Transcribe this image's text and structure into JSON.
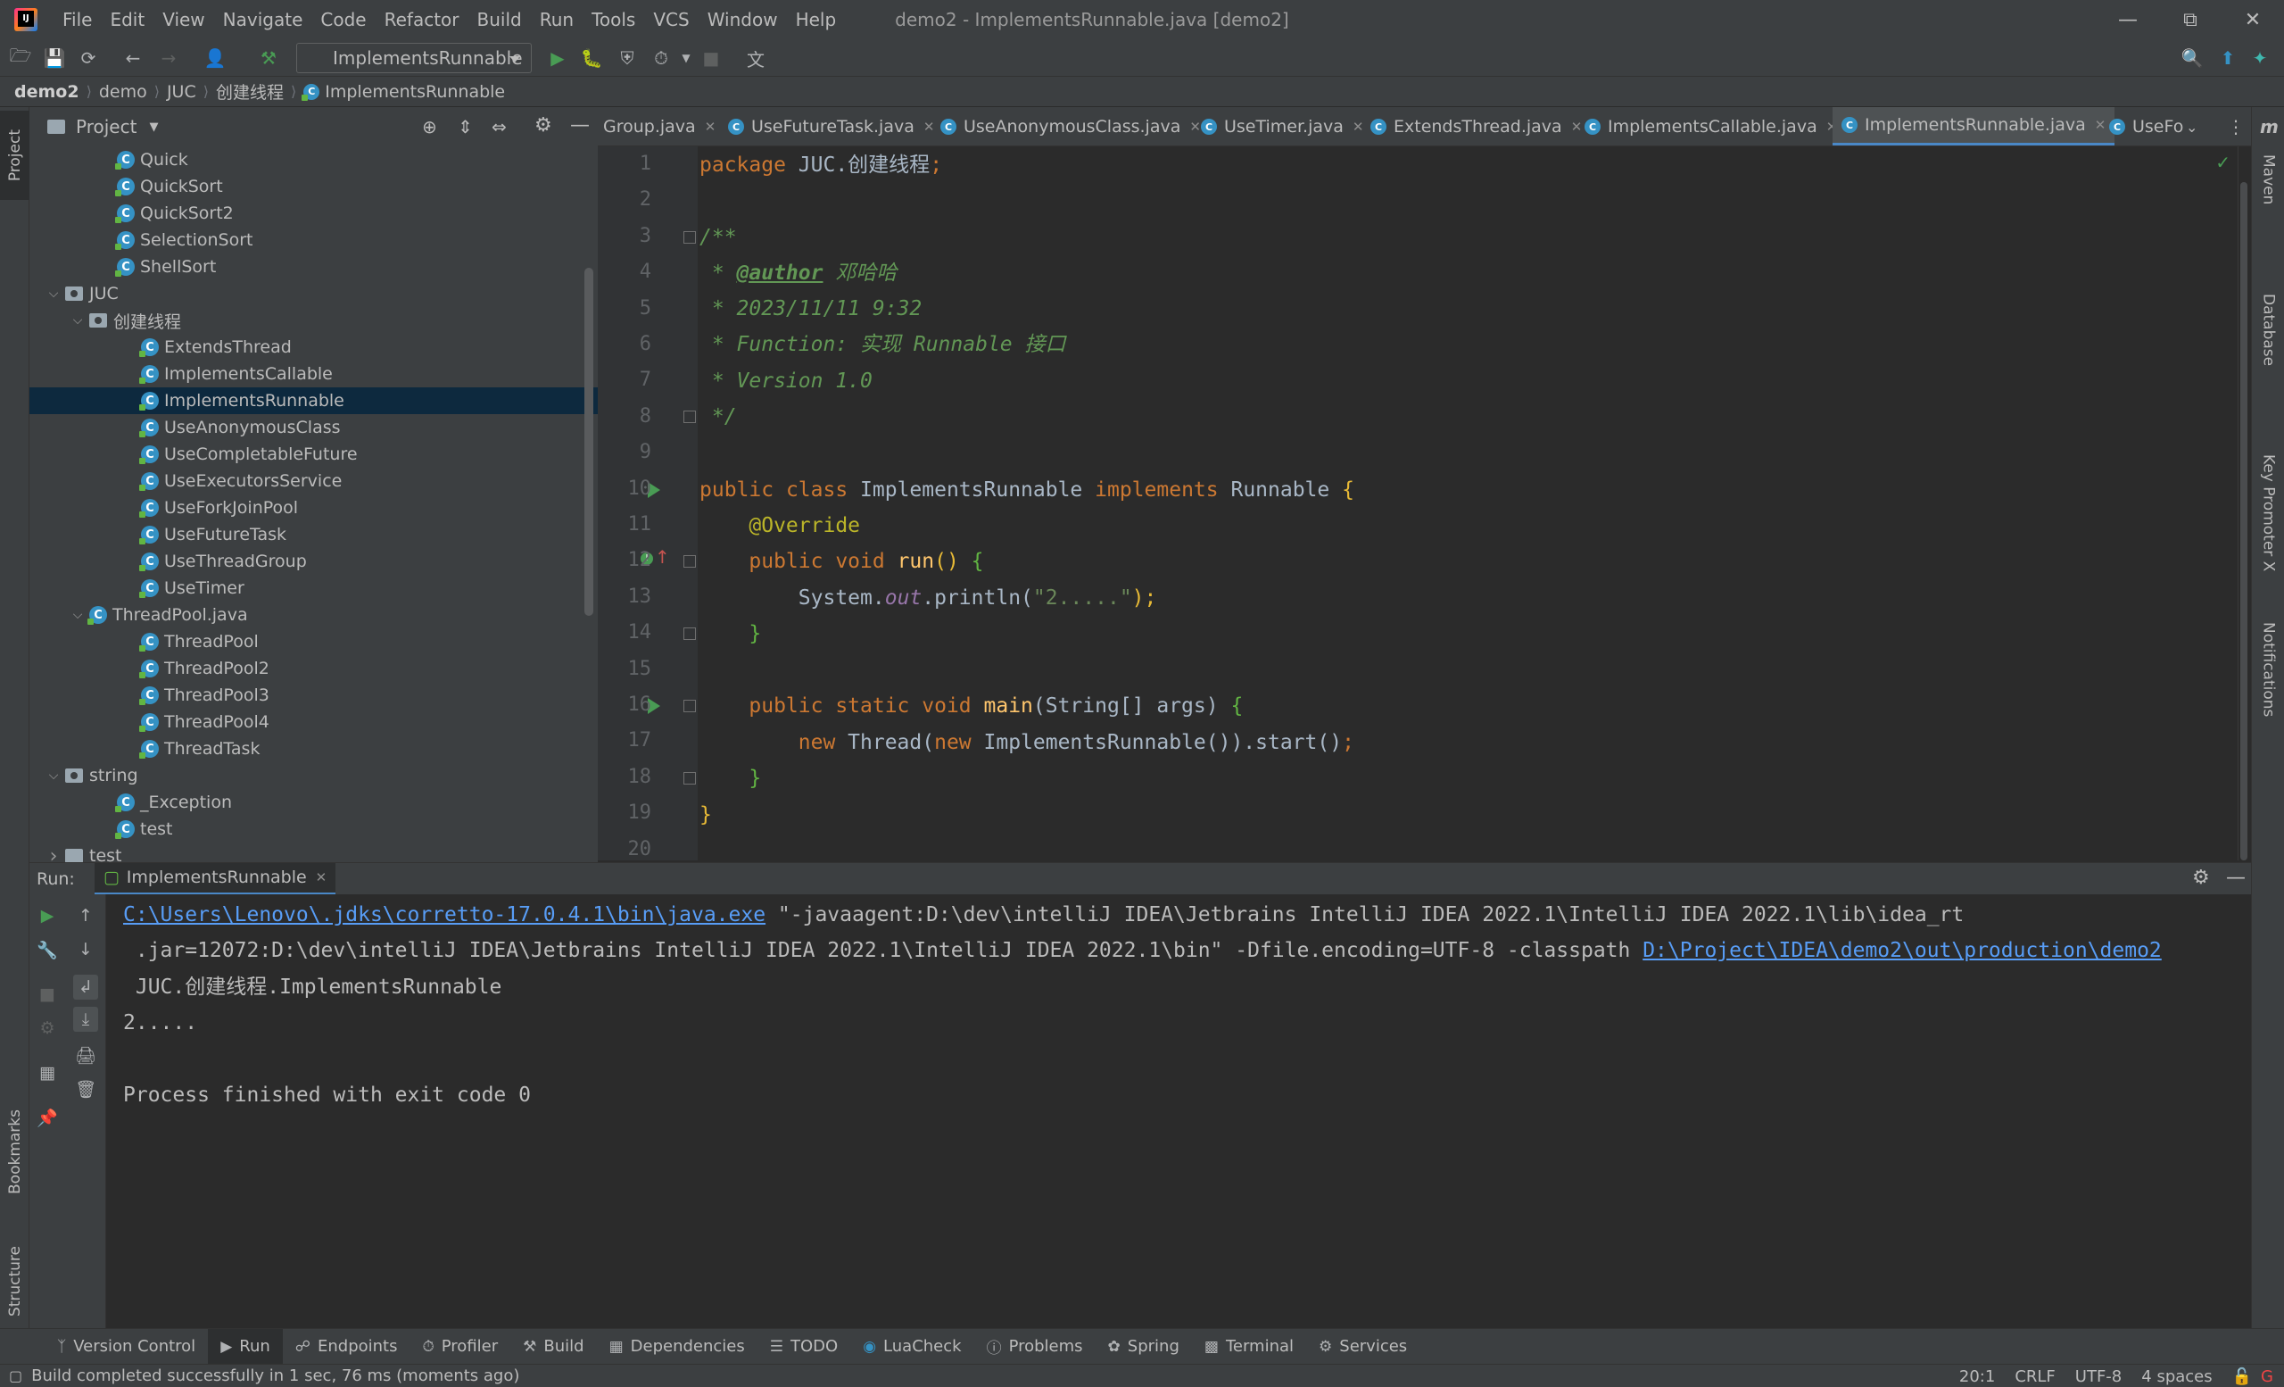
{
  "titlebar": {
    "menus": [
      {
        "label": "File"
      },
      {
        "label": "Edit"
      },
      {
        "label": "View"
      },
      {
        "label": "Navigate"
      },
      {
        "label": "Code"
      },
      {
        "label": "Refactor"
      },
      {
        "label": "Build"
      },
      {
        "label": "Run"
      },
      {
        "label": "Tools"
      },
      {
        "label": "VCS"
      },
      {
        "label": "Window"
      },
      {
        "label": "Help"
      }
    ],
    "window_title": "demo2 - ImplementsRunnable.java [demo2]"
  },
  "toolbar": {
    "run_config": "ImplementsRunnable"
  },
  "breadcrumb": [
    "demo2",
    "demo",
    "JUC",
    "创建线程",
    "ImplementsRunnable"
  ],
  "left_stripe": {
    "project": "Project",
    "bookmarks": "Bookmarks",
    "structure": "Structure"
  },
  "right_stripe": {
    "maven": "Maven",
    "database": "Database",
    "key_promoter": "Key Promoter X",
    "notifications": "Notifications"
  },
  "project_panel": {
    "title": "Project",
    "tree": [
      {
        "label": "Quick",
        "type": "class"
      },
      {
        "label": "QuickSort",
        "type": "class"
      },
      {
        "label": "QuickSort2",
        "type": "class"
      },
      {
        "label": "SelectionSort",
        "type": "class"
      },
      {
        "label": "ShellSort",
        "type": "class"
      },
      {
        "label": "JUC",
        "type": "package",
        "expanded": true
      },
      {
        "label": "创建线程",
        "type": "package",
        "expanded": true
      },
      {
        "label": "ExtendsThread",
        "type": "class"
      },
      {
        "label": "ImplementsCallable",
        "type": "class"
      },
      {
        "label": "ImplementsRunnable",
        "type": "class",
        "selected": true
      },
      {
        "label": "UseAnonymousClass",
        "type": "class"
      },
      {
        "label": "UseCompletableFuture",
        "type": "class"
      },
      {
        "label": "UseExecutorsService",
        "type": "class"
      },
      {
        "label": "UseForkJoinPool",
        "type": "class"
      },
      {
        "label": "UseFutureTask",
        "type": "class"
      },
      {
        "label": "UseThreadGroup",
        "type": "class"
      },
      {
        "label": "UseTimer",
        "type": "class"
      },
      {
        "label": "ThreadPool.java",
        "type": "file",
        "expanded": true
      },
      {
        "label": "ThreadPool",
        "type": "class"
      },
      {
        "label": "ThreadPool2",
        "type": "class"
      },
      {
        "label": "ThreadPool3",
        "type": "class"
      },
      {
        "label": "ThreadPool4",
        "type": "class"
      },
      {
        "label": "ThreadTask",
        "type": "class"
      },
      {
        "label": "string",
        "type": "package",
        "expanded": true
      },
      {
        "label": "_Exception",
        "type": "class"
      },
      {
        "label": "test",
        "type": "class"
      },
      {
        "label": "test",
        "type": "folder",
        "expanded": false
      }
    ]
  },
  "editor_tabs": [
    {
      "label": "Group.java"
    },
    {
      "label": "UseFutureTask.java"
    },
    {
      "label": "UseAnonymousClass.java"
    },
    {
      "label": "UseTimer.java"
    },
    {
      "label": "ExtendsThread.java"
    },
    {
      "label": "ImplementsCallable.java"
    },
    {
      "label": "ImplementsRunnable.java",
      "active": true
    },
    {
      "label": "UseFo"
    }
  ],
  "code": {
    "line_numbers": [
      "1",
      "2",
      "3",
      "4",
      "5",
      "6",
      "7",
      "8",
      "9",
      "10",
      "11",
      "12",
      "13",
      "14",
      "15",
      "16",
      "17",
      "18",
      "19",
      "20"
    ],
    "l1_kw": "package",
    "l1_rest": " JUC.创建线程",
    "l1_semi": ";",
    "l3": "/**",
    "l4_star": " * ",
    "l4_tag": "@author",
    "l4_rest": " 邓哈哈",
    "l5": " * 2023/11/11 9:32",
    "l6": " * Function: 实现 Runnable 接口",
    "l7": " * Version 1.0",
    "l8": " */",
    "l10_public": "public ",
    "l10_class": "class ",
    "l10_name": "ImplementsRunnable ",
    "l10_impl": "implements ",
    "l10_iface": "Runnable ",
    "l10_brace": "{",
    "l11": "    @Override",
    "l12_mods": "    public void ",
    "l12_fn": "run",
    "l12_parens": "() ",
    "l12_brace": "{",
    "l13_sys": "        System.",
    "l13_out": "out",
    "l13_println": ".println(",
    "l13_str": "\"2.....\"",
    "l13_end": ");",
    "l14": "    }",
    "l16_mods": "    public static void ",
    "l16_fn": "main",
    "l16_args": "(String[] args) ",
    "l16_brace": "{",
    "l17_new": "        new ",
    "l17_thread": "Thread(",
    "l17_new2": "new ",
    "l17_impl": "ImplementsRunnable()).start()",
    "l17_semi": ";",
    "l18": "    }",
    "l19": "}"
  },
  "run_panel": {
    "label": "Run:",
    "tab": "ImplementsRunnable",
    "console": {
      "l1_link": "C:\\Users\\Lenovo\\.jdks\\corretto-17.0.4.1\\bin\\java.exe",
      "l1_rest": " \"-javaagent:D:\\dev\\intelliJ IDEA\\Jetbrains IntelliJ IDEA 2022.1\\IntelliJ IDEA 2022.1\\lib\\idea_rt",
      "l2_rest": " .jar=12072:D:\\dev\\intelliJ IDEA\\Jetbrains IntelliJ IDEA 2022.1\\IntelliJ IDEA 2022.1\\bin\" -Dfile.encoding=UTF-8 -classpath ",
      "l2_link": "D:\\Project\\IDEA\\demo2\\out\\production\\demo2",
      "l3": " JUC.创建线程.ImplementsRunnable",
      "l4": "2.....",
      "l6": "Process finished with exit code 0"
    }
  },
  "tool_windows": [
    {
      "label": "Version Control"
    },
    {
      "label": "Run",
      "active": true
    },
    {
      "label": "Endpoints"
    },
    {
      "label": "Profiler"
    },
    {
      "label": "Build"
    },
    {
      "label": "Dependencies"
    },
    {
      "label": "TODO"
    },
    {
      "label": "LuaCheck"
    },
    {
      "label": "Problems"
    },
    {
      "label": "Spring"
    },
    {
      "label": "Terminal"
    },
    {
      "label": "Services"
    }
  ],
  "status": {
    "message": "Build completed successfully in 1 sec, 76 ms (moments ago)",
    "position": "20:1",
    "line_sep": "CRLF",
    "encoding": "UTF-8",
    "indent": "4 spaces"
  },
  "colors": {
    "selection": "#0d293e",
    "keyword": "#cc7832",
    "comment": "#629755",
    "link": "#589df6",
    "run_green": "#499c54"
  }
}
